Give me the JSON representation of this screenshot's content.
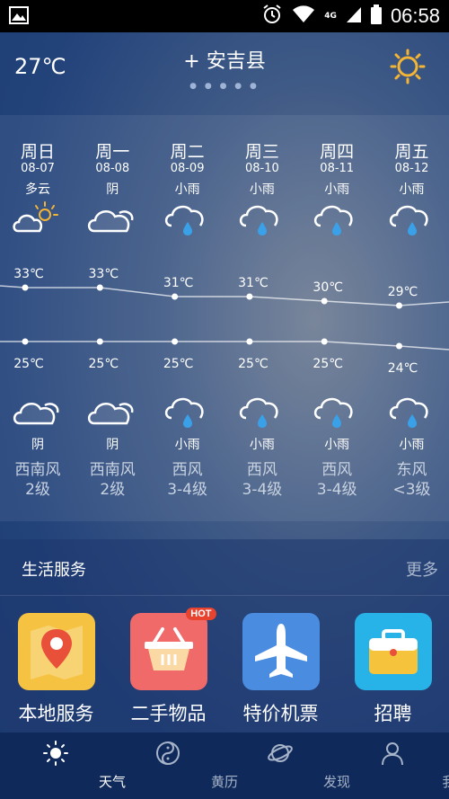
{
  "status_bar": {
    "time": "06:58",
    "network": "4G"
  },
  "header": {
    "current_temp": "27℃",
    "city": "+ 安吉县",
    "page_dots": "● ● ● ● ●"
  },
  "forecast": [
    {
      "day": "周日",
      "date": "08-07",
      "cond_day": "多云",
      "high": "33℃",
      "low": "25℃",
      "cond_night": "阴",
      "wind_dir": "西南风",
      "wind_lvl": "2级",
      "icon_day": "partly-cloudy-icon",
      "icon_night": "cloud-icon"
    },
    {
      "day": "周一",
      "date": "08-08",
      "cond_day": "阴",
      "high": "33℃",
      "low": "25℃",
      "cond_night": "阴",
      "wind_dir": "西南风",
      "wind_lvl": "2级",
      "icon_day": "cloud-icon",
      "icon_night": "cloud-icon"
    },
    {
      "day": "周二",
      "date": "08-09",
      "cond_day": "小雨",
      "high": "31℃",
      "low": "25℃",
      "cond_night": "小雨",
      "wind_dir": "西风",
      "wind_lvl": "3-4级",
      "icon_day": "rain-icon",
      "icon_night": "rain-icon"
    },
    {
      "day": "周三",
      "date": "08-10",
      "cond_day": "小雨",
      "high": "31℃",
      "low": "25℃",
      "cond_night": "小雨",
      "wind_dir": "西风",
      "wind_lvl": "3-4级",
      "icon_day": "rain-icon",
      "icon_night": "rain-icon"
    },
    {
      "day": "周四",
      "date": "08-11",
      "cond_day": "小雨",
      "high": "30℃",
      "low": "25℃",
      "cond_night": "小雨",
      "wind_dir": "西风",
      "wind_lvl": "3-4级",
      "icon_day": "rain-icon",
      "icon_night": "rain-icon"
    },
    {
      "day": "周五",
      "date": "08-12",
      "cond_day": "小雨",
      "high": "29℃",
      "low": "24℃",
      "cond_night": "小雨",
      "wind_dir": "东风",
      "wind_lvl": "<3级",
      "icon_day": "rain-icon",
      "icon_night": "rain-icon"
    }
  ],
  "temps": {
    "high": [
      33,
      33,
      31,
      31,
      30,
      29
    ],
    "low": [
      25,
      25,
      25,
      25,
      25,
      24
    ]
  },
  "services": {
    "title": "生活服务",
    "more": "更多",
    "items": [
      {
        "label": "本地服务",
        "icon": "map-pin-icon",
        "color": "#f5c242"
      },
      {
        "label": "二手物品",
        "icon": "basket-icon",
        "color": "#f06a6a",
        "badge": "HOT"
      },
      {
        "label": "特价机票",
        "icon": "airplane-icon",
        "color": "#4a8de0"
      },
      {
        "label": "招聘",
        "icon": "briefcase-icon",
        "color": "#27b3e8"
      }
    ]
  },
  "tabs": [
    {
      "label": "天气",
      "icon": "sun-icon",
      "active": true
    },
    {
      "label": "黄历",
      "icon": "yinyang-icon",
      "active": false
    },
    {
      "label": "发现",
      "icon": "planet-icon",
      "active": false
    },
    {
      "label": "我",
      "icon": "user-icon",
      "active": false
    }
  ],
  "colors": {
    "sun": "#f4b434",
    "rain_drop": "#3aa0e8",
    "tab_bar": "#0f2a5a"
  }
}
